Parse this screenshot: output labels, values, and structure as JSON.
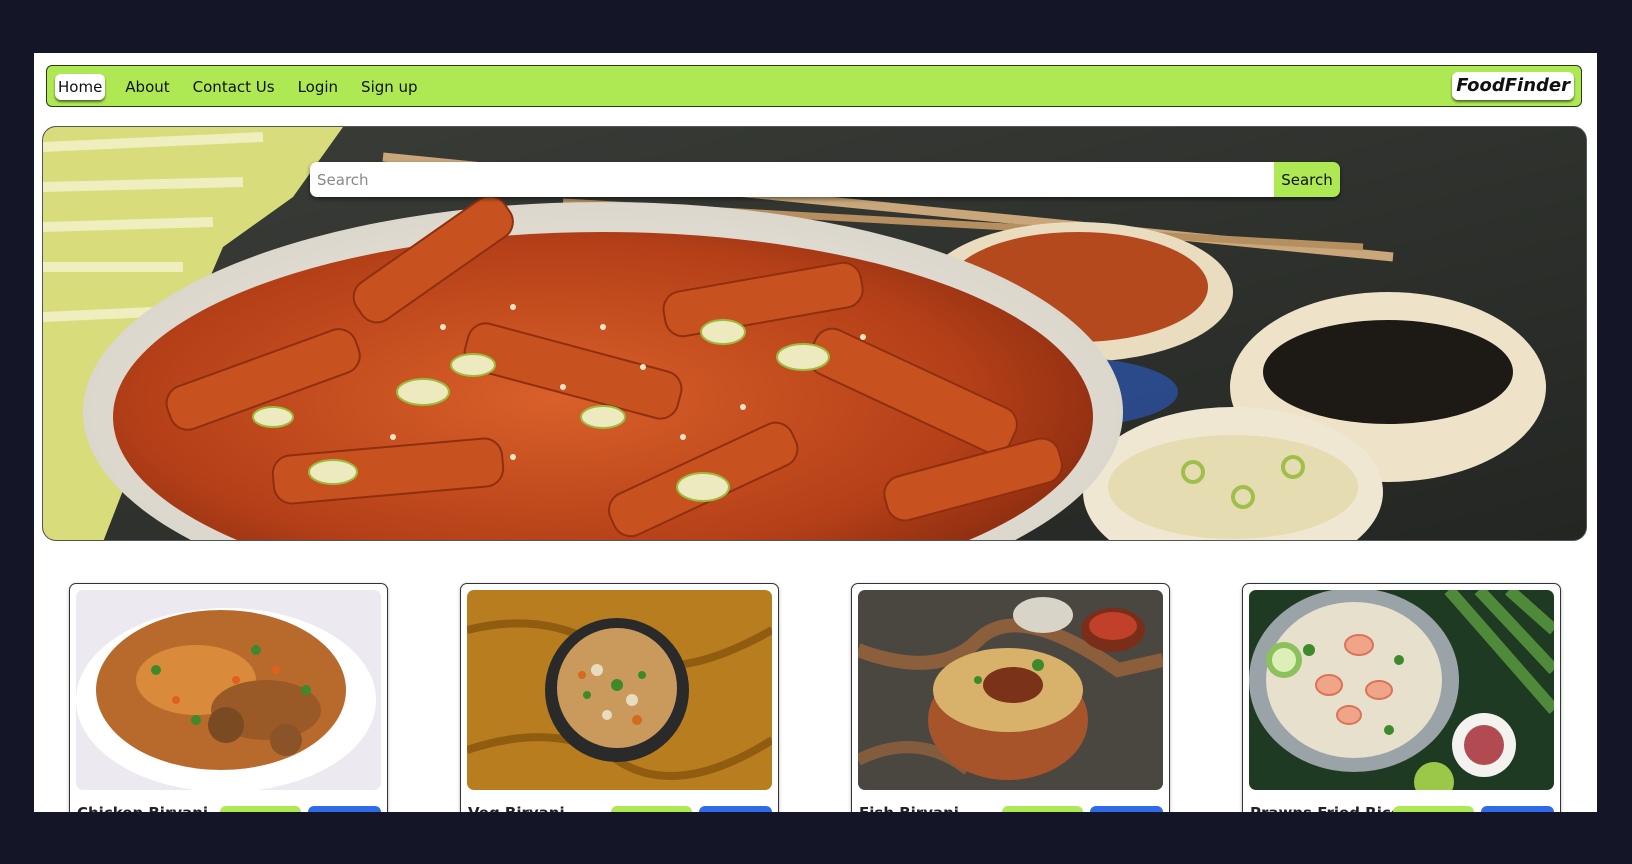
{
  "nav": {
    "items": [
      {
        "label": "Home",
        "active": true
      },
      {
        "label": "About"
      },
      {
        "label": "Contact Us"
      },
      {
        "label": "Login"
      },
      {
        "label": "Sign up"
      }
    ],
    "brand": "FoodFinder"
  },
  "search": {
    "placeholder": "Search",
    "value": "",
    "button_label": "Search"
  },
  "hero": {
    "image": "spicy stir-fried rice cakes with sesame and scallions, dipping sauce bowls"
  },
  "cards": [
    {
      "title": "Chicken Biryani",
      "image": "chicken biryani on white plate"
    },
    {
      "title": "Veg Biryani",
      "image": "veg biryani in black bowl on mustard cloth"
    },
    {
      "title": "Fish Biryani",
      "image": "fish biryani in copper bowl"
    },
    {
      "title": "Prawns Fried Rice",
      "image": "prawns fried rice with cucumber and lime"
    }
  ],
  "colors": {
    "accent": "#aee852",
    "secondary_button": "#2f6be8",
    "frame": "#141526"
  }
}
